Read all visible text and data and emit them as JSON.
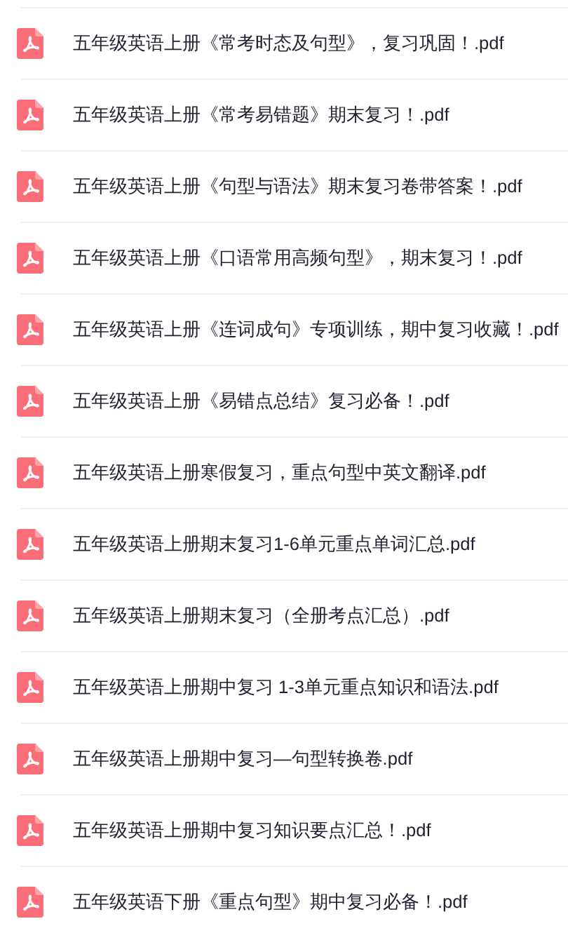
{
  "files": [
    {
      "name": "五年级英语上册《常考时态及句型》，复习巩固！.pdf"
    },
    {
      "name": "五年级英语上册《常考易错题》期末复习！.pdf"
    },
    {
      "name": "五年级英语上册《句型与语法》期末复习卷带答案！.pdf"
    },
    {
      "name": "五年级英语上册《口语常用高频句型》，期末复习！.pdf"
    },
    {
      "name": "五年级英语上册《连词成句》专项训练，期中复习收藏！.pdf"
    },
    {
      "name": "五年级英语上册《易错点总结》复习必备！.pdf"
    },
    {
      "name": "五年级英语上册寒假复习，重点句型中英文翻译.pdf"
    },
    {
      "name": "五年级英语上册期末复习1-6单元重点单词汇总.pdf"
    },
    {
      "name": "五年级英语上册期末复习（全册考点汇总）.pdf"
    },
    {
      "name": "五年级英语上册期中复习 1-3单元重点知识和语法.pdf"
    },
    {
      "name": "五年级英语上册期中复习—句型转换卷.pdf"
    },
    {
      "name": "五年级英语上册期中复习知识要点汇总！.pdf"
    },
    {
      "name": "五年级英语下册《重点句型》期中复习必备！.pdf"
    }
  ]
}
